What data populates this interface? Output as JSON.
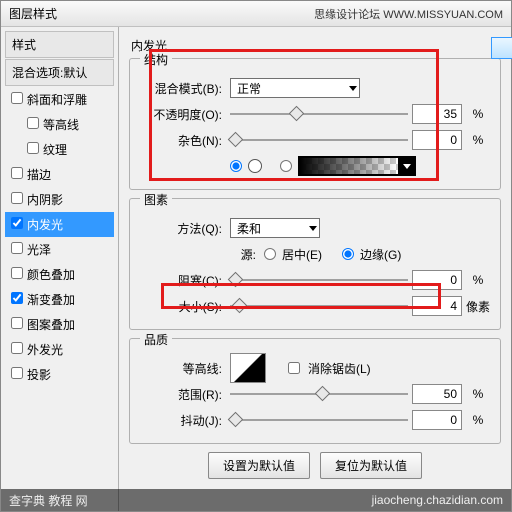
{
  "title": "图层样式",
  "header_right": "思缘设计论坛    WWW.MISSYUAN.COM",
  "sidebar": {
    "head1": "样式",
    "head2": "混合选项:默认",
    "items": [
      {
        "label": "斜面和浮雕",
        "checked": false
      },
      {
        "label": "等高线",
        "checked": false,
        "indent": true
      },
      {
        "label": "纹理",
        "checked": false,
        "indent": true
      },
      {
        "label": "描边",
        "checked": false
      },
      {
        "label": "内阴影",
        "checked": false
      },
      {
        "label": "内发光",
        "checked": true,
        "selected": true
      },
      {
        "label": "光泽",
        "checked": false
      },
      {
        "label": "颜色叠加",
        "checked": false
      },
      {
        "label": "渐变叠加",
        "checked": true
      },
      {
        "label": "图案叠加",
        "checked": false
      },
      {
        "label": "外发光",
        "checked": false
      },
      {
        "label": "投影",
        "checked": false
      }
    ]
  },
  "main": {
    "panel_title": "内发光",
    "group_struct": "结构",
    "blend_label": "混合模式(B):",
    "blend_value": "正常",
    "opacity_label": "不透明度(O):",
    "opacity_value": "35",
    "pct": "%",
    "noise_label": "杂色(N):",
    "noise_value": "0",
    "group_elem": "图素",
    "method_label": "方法(Q):",
    "method_value": "柔和",
    "source_label": "源:",
    "source_center": "居中(E)",
    "source_edge": "边缘(G)",
    "choke_label": "阻塞(C):",
    "choke_value": "0",
    "size_label": "大小(S):",
    "size_value": "4",
    "px": "像素",
    "group_quality": "品质",
    "contour_label": "等高线:",
    "antialias": "消除锯齿(L)",
    "range_label": "范围(R):",
    "range_value": "50",
    "jitter_label": "抖动(J):",
    "jitter_value": "0",
    "btn_default": "设置为默认值",
    "btn_reset": "复位为默认值"
  },
  "watermark_left": "查字典 教程 网",
  "watermark_right": "jiaocheng.chazidian.com"
}
